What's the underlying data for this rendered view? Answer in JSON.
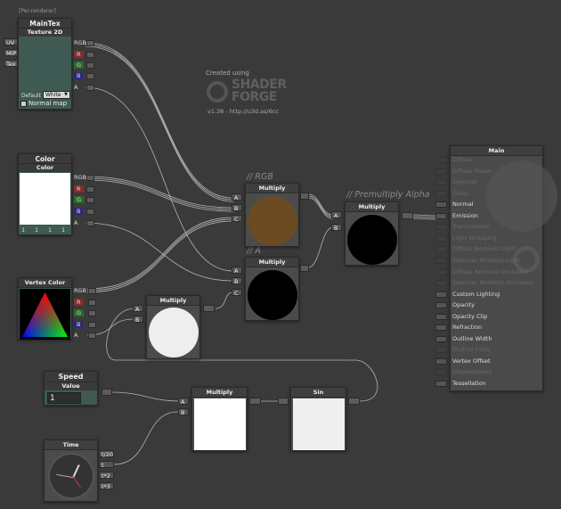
{
  "prerender": "[Per-renderer]",
  "logo": {
    "created": "Created using",
    "line1": "SHADER",
    "line2": "FORGE",
    "version": "v1.38 - http://u3d.as/6cc"
  },
  "maintex": {
    "title": "MainTex",
    "subtitle": "Texture 2D",
    "inputs": [
      "UV",
      "MIP",
      "Tex"
    ],
    "outputs": [
      "RGB",
      "R",
      "G",
      "B",
      "A"
    ],
    "default_label": "Default",
    "default_value": "White",
    "normal_map": "Normal map"
  },
  "color": {
    "title": "Color",
    "subtitle": "Color",
    "outputs": [
      "RGB",
      "R",
      "G",
      "B",
      "A"
    ],
    "values": [
      "1",
      "1",
      "1",
      "1"
    ]
  },
  "vertex_color": {
    "title": "Vertex Color",
    "outputs": [
      "RGB",
      "R",
      "G",
      "B",
      "A"
    ]
  },
  "speed": {
    "title": "Speed",
    "subtitle": "Value",
    "value": "1"
  },
  "time": {
    "title": "Time",
    "outputs": [
      "t/20",
      "t",
      "t*2",
      "t*3"
    ]
  },
  "comments": {
    "rgb": "// RGB",
    "a": "// A",
    "premult": "// Premultiply Alpha"
  },
  "multiply_rgb": {
    "title": "Multiply",
    "inputs": [
      "A",
      "B",
      "C"
    ],
    "preview_color": "#6b4b22"
  },
  "multiply_a": {
    "title": "Multiply",
    "inputs": [
      "A",
      "B",
      "C"
    ],
    "preview_color": "#000000"
  },
  "multiply_premult": {
    "title": "Multiply",
    "inputs": [
      "A",
      "B"
    ],
    "preview_color": "#000000"
  },
  "multiply_vc": {
    "title": "Multiply",
    "inputs": [
      "A",
      "B"
    ],
    "preview_color": "#eeeeee"
  },
  "multiply_time": {
    "title": "Multiply",
    "inputs": [
      "A",
      "B"
    ]
  },
  "sin": {
    "title": "Sin"
  },
  "main": {
    "title": "Main",
    "rows": [
      {
        "label": "Diffuse",
        "enabled": false
      },
      {
        "label": "Diffuse Power",
        "enabled": false
      },
      {
        "label": "Specular",
        "enabled": false
      },
      {
        "label": "Gloss",
        "enabled": false
      },
      {
        "label": "Normal",
        "enabled": true
      },
      {
        "label": "Emission",
        "enabled": true
      },
      {
        "label": "Transmission",
        "enabled": false
      },
      {
        "label": "Light Wrapping",
        "enabled": false
      },
      {
        "label": "Diffuse Ambient Light",
        "enabled": false
      },
      {
        "label": "Specular Ambient Light",
        "enabled": false
      },
      {
        "label": "Diffuse Ambient Occlusion",
        "enabled": false
      },
      {
        "label": "Specular Ambient Occlusion",
        "enabled": false
      },
      {
        "label": "Custom Lighting",
        "enabled": true
      },
      {
        "label": "Opacity",
        "enabled": true
      },
      {
        "label": "Opacity Clip",
        "enabled": true
      },
      {
        "label": "Refraction",
        "enabled": true
      },
      {
        "label": "Outline Width",
        "enabled": true
      },
      {
        "label": "Outline Color",
        "enabled": false
      },
      {
        "label": "Vertex Offset",
        "enabled": true
      },
      {
        "label": "Displacement",
        "enabled": false
      },
      {
        "label": "Tessellation",
        "enabled": true
      }
    ]
  }
}
